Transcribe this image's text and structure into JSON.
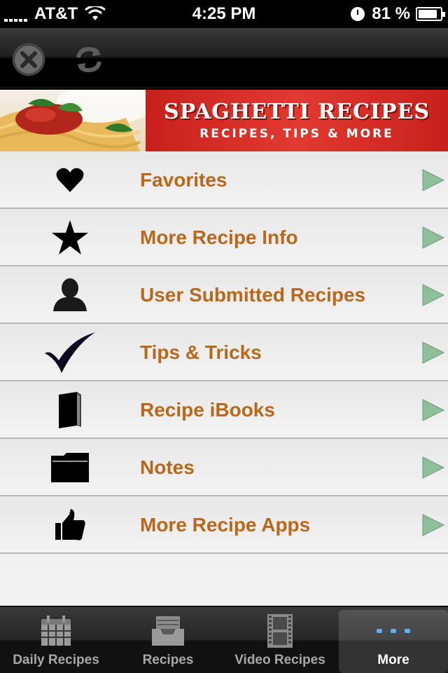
{
  "status_bar": {
    "carrier": "AT&T",
    "time": "4:25 PM",
    "battery_percent": "81 %"
  },
  "toolbar": {
    "close_icon": "close-icon",
    "refresh_icon": "refresh-icon"
  },
  "banner": {
    "title": "SPAGHETTI RECIPES",
    "subtitle": "RECIPES, TIPS & MORE"
  },
  "menu": {
    "items": [
      {
        "label": "Favorites",
        "icon": "heart-icon"
      },
      {
        "label": "More Recipe Info",
        "icon": "star-icon"
      },
      {
        "label": "User Submitted Recipes",
        "icon": "user-icon"
      },
      {
        "label": "Tips & Tricks",
        "icon": "checkmark-icon"
      },
      {
        "label": "Recipe iBooks",
        "icon": "book-icon"
      },
      {
        "label": "Notes",
        "icon": "folder-icon"
      },
      {
        "label": "More Recipe Apps",
        "icon": "thumbs-up-icon"
      }
    ],
    "label_color": "#b7681a",
    "arrow_color": "#8fbf9a"
  },
  "tab_bar": {
    "tabs": [
      {
        "label": "Daily Recipes",
        "icon": "calendar-icon",
        "active": false
      },
      {
        "label": "Recipes",
        "icon": "inbox-icon",
        "active": false
      },
      {
        "label": "Video Recipes",
        "icon": "film-icon",
        "active": false
      },
      {
        "label": "More",
        "icon": "more-icon",
        "active": true
      }
    ]
  }
}
